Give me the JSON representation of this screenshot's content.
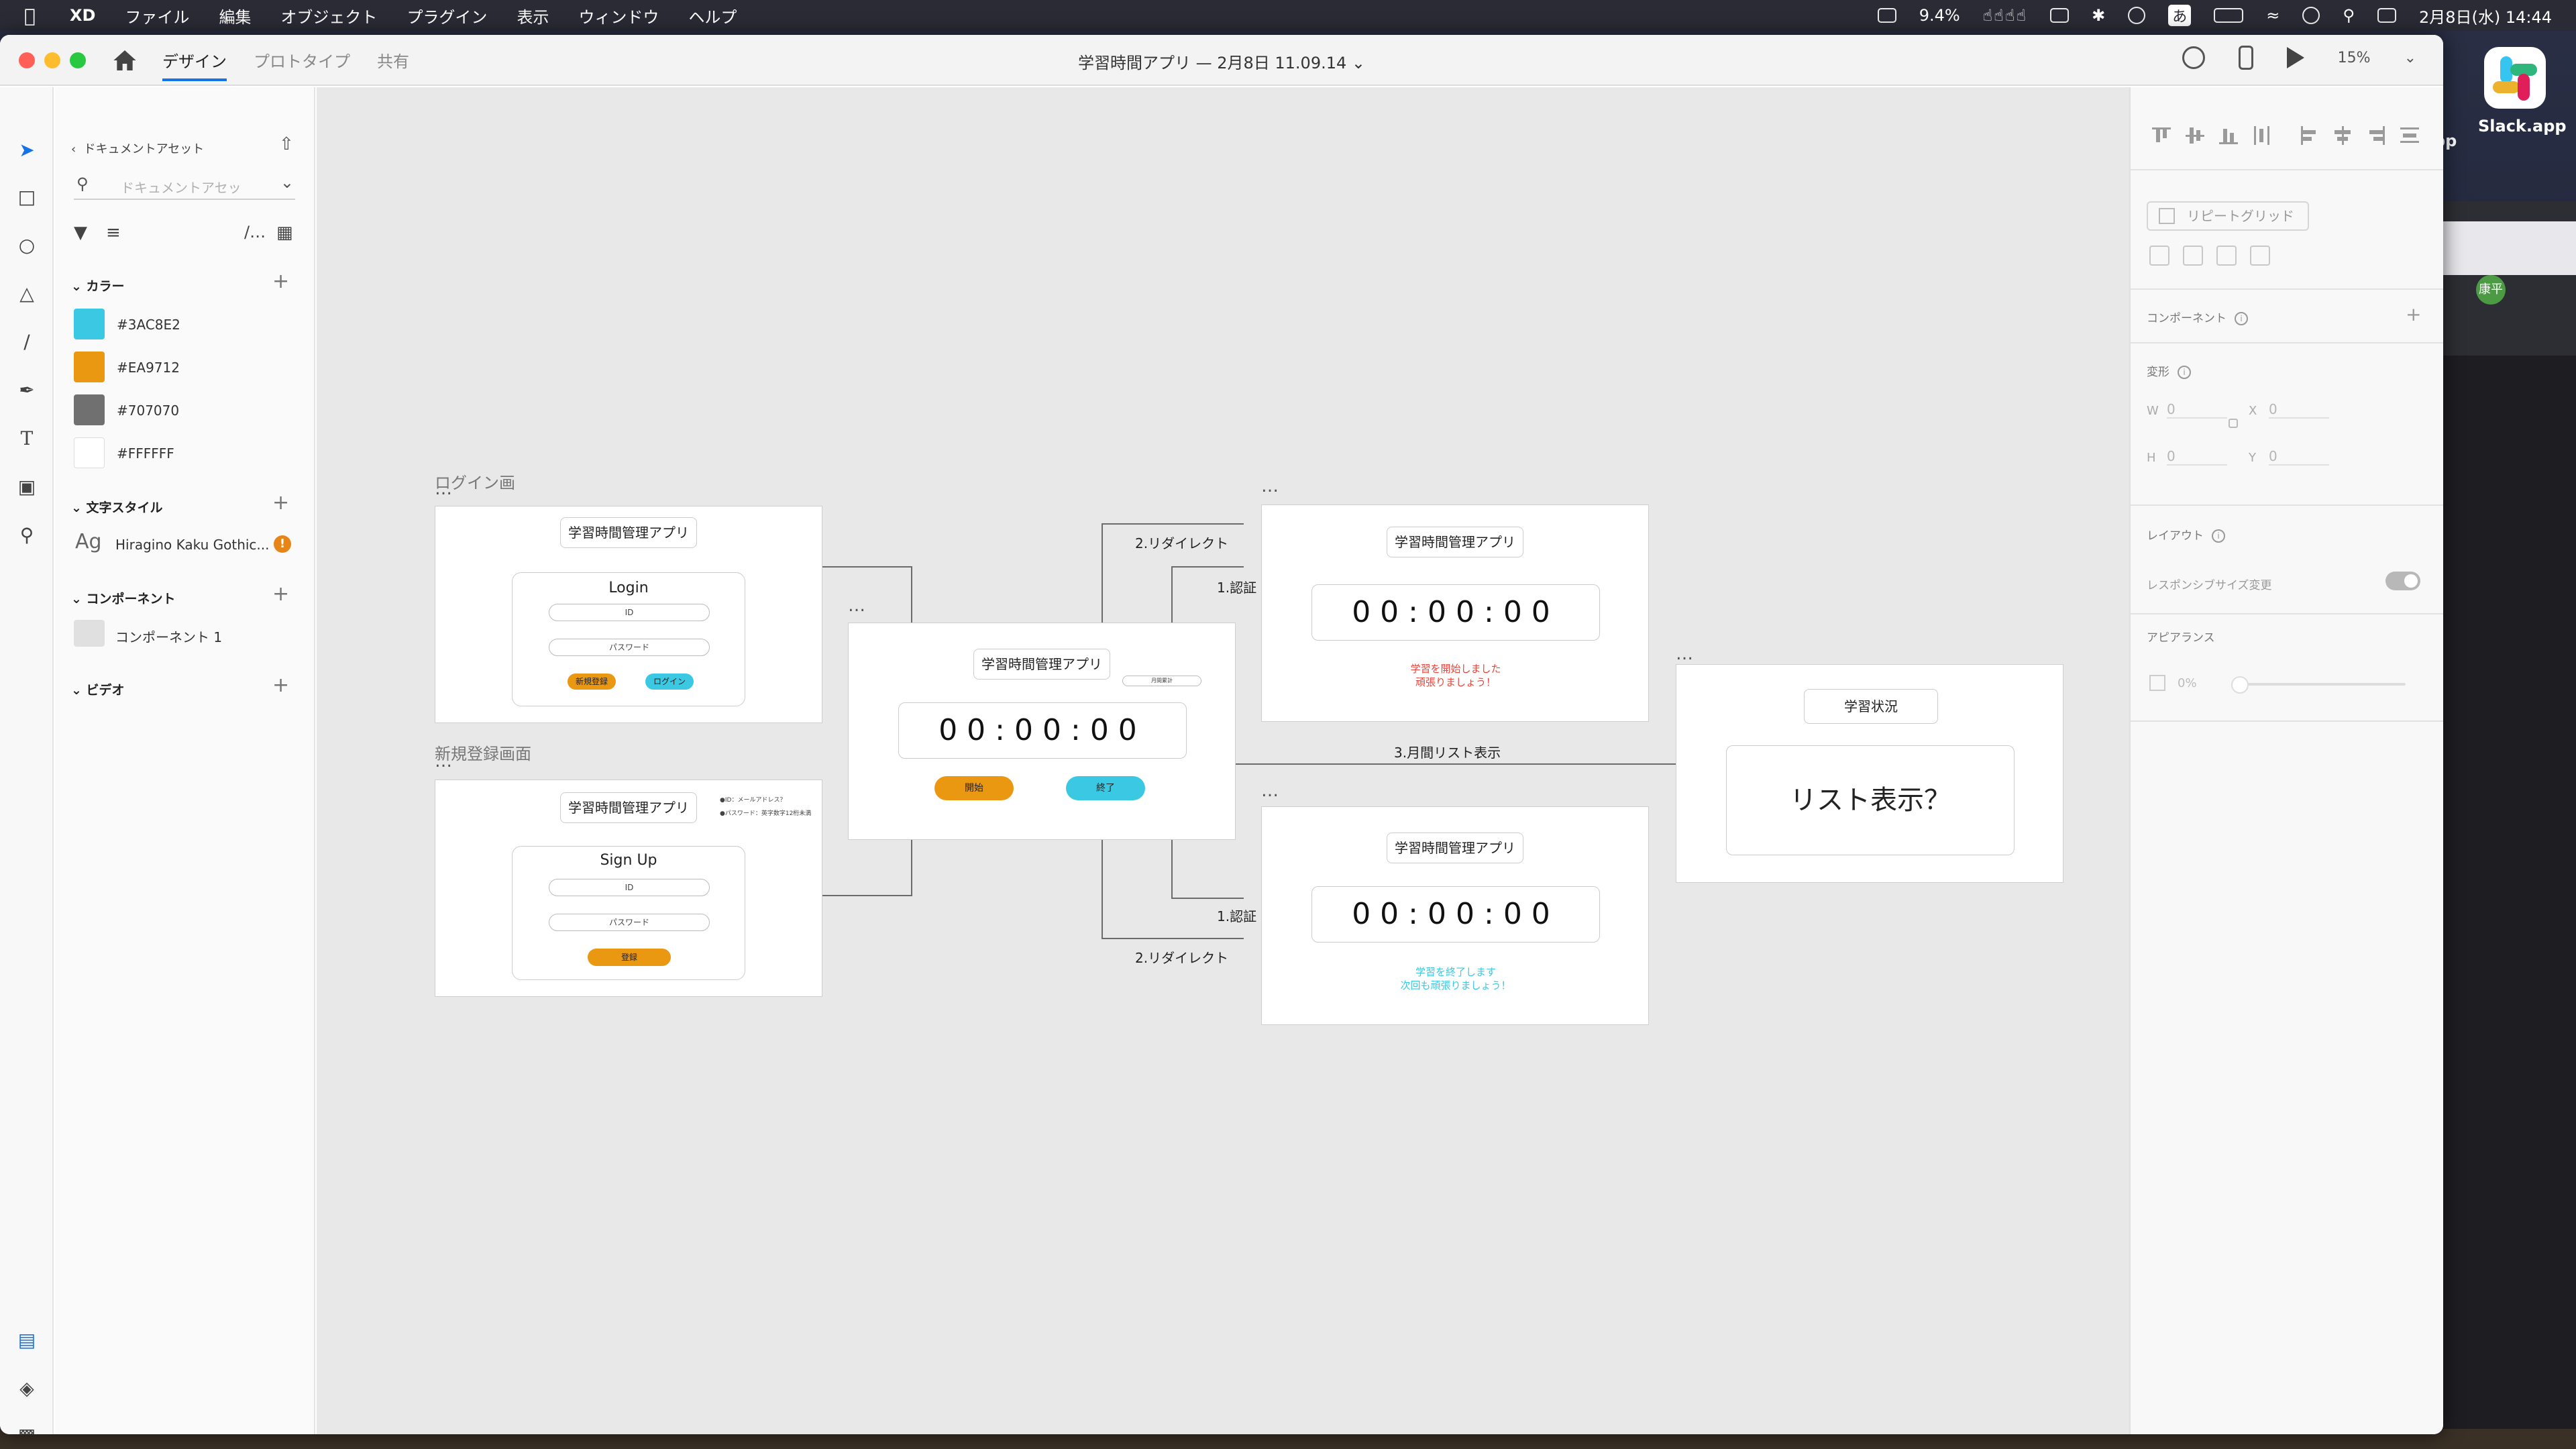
{
  "menubar": {
    "app": "XD",
    "items": [
      "ファイル",
      "編集",
      "オブジェクト",
      "プラグイン",
      "表示",
      "ウィンドウ",
      "ヘルプ"
    ],
    "cpu": "9.4%",
    "ime": "あ",
    "datetime": "2月8日(水) 14:44"
  },
  "desktop": {
    "slack_label": "Slack.app",
    "partial_label": "pp",
    "avatar_text": "康平"
  },
  "titlebar": {
    "tabs": [
      "デザイン",
      "プロトタイプ",
      "共有"
    ],
    "doc_title": "学習時間アプリ — 2月8日 11.09.14",
    "zoom": "15%"
  },
  "assets": {
    "crumb": "ドキュメントアセット",
    "search_placeholder": "ドキュメントアセッ",
    "colors_title": "カラー",
    "colors": [
      {
        "hex": "#3AC8E2",
        "label": "#3AC8E2"
      },
      {
        "hex": "#EA9712",
        "label": "#EA9712"
      },
      {
        "hex": "#707070",
        "label": "#707070"
      },
      {
        "hex": "#FFFFFF",
        "label": "#FFFFFF"
      }
    ],
    "text_styles_title": "文字スタイル",
    "text_style_ag": "Ag",
    "text_style_name": "Hiragino Kaku Gothic...",
    "text_style_warning": "!",
    "components_title": "コンポーネント",
    "component_name": "コンポーネント 1",
    "video_title": "ビデオ"
  },
  "canvas": {
    "login": {
      "name": "ログイン画",
      "dots": "…",
      "header": "学習時間管理アプリ",
      "title": "Login",
      "id_field": "ID",
      "password_field": "パスワード",
      "signup_button": "新規登録",
      "login_button": "ログイン"
    },
    "signup": {
      "name": "新規登録画面",
      "dots": "…",
      "header": "学習時間管理アプリ",
      "note1": "●ID：メールアドレス？",
      "note2": "●パスワード：英字数字12桁未満",
      "title": "Sign Up",
      "id_field": "ID",
      "password_field": "パスワード",
      "register_button": "登録"
    },
    "timer_main": {
      "dots": "…",
      "header": "学習時間管理アプリ",
      "side_pill": "月間累計",
      "time": "00:00:00",
      "start_button": "開始",
      "end_button": "終了"
    },
    "timer_start": {
      "dots": "…",
      "header": "学習時間管理アプリ",
      "time": "00:00:00",
      "msg1": "学習を開始しました",
      "msg2": "頑張りましょう！"
    },
    "timer_end": {
      "dots": "…",
      "header": "学習時間管理アプリ",
      "time": "00:00:00",
      "msg1": "学習を終了します",
      "msg2": "次回も頑張りましょう！"
    },
    "status": {
      "dots": "…",
      "header": "学習状況",
      "body": "リスト表示？"
    },
    "flow_labels": {
      "redirect_top": "2.リダイレクト",
      "auth_top": "1.認証",
      "monthly": "3.月間リスト表示",
      "auth_bottom": "1.認証",
      "redirect_bottom": "2.リダイレクト"
    },
    "accent_orange": "#EA9712",
    "accent_cyan": "#3AC8E2",
    "start_msg_color": "#e8453c",
    "end_msg_color": "#3AC8E2"
  },
  "props": {
    "repeat_grid": "リピートグリッド",
    "component": "コンポーネント",
    "transform": "変形",
    "w_label": "W",
    "w_value": "0",
    "x_label": "X",
    "x_value": "0",
    "h_label": "H",
    "h_value": "0",
    "y_label": "Y",
    "y_value": "0",
    "layout": "レイアウト",
    "responsive": "レスポンシブサイズ変更",
    "appearance": "アピアランス",
    "opacity": "0%"
  }
}
